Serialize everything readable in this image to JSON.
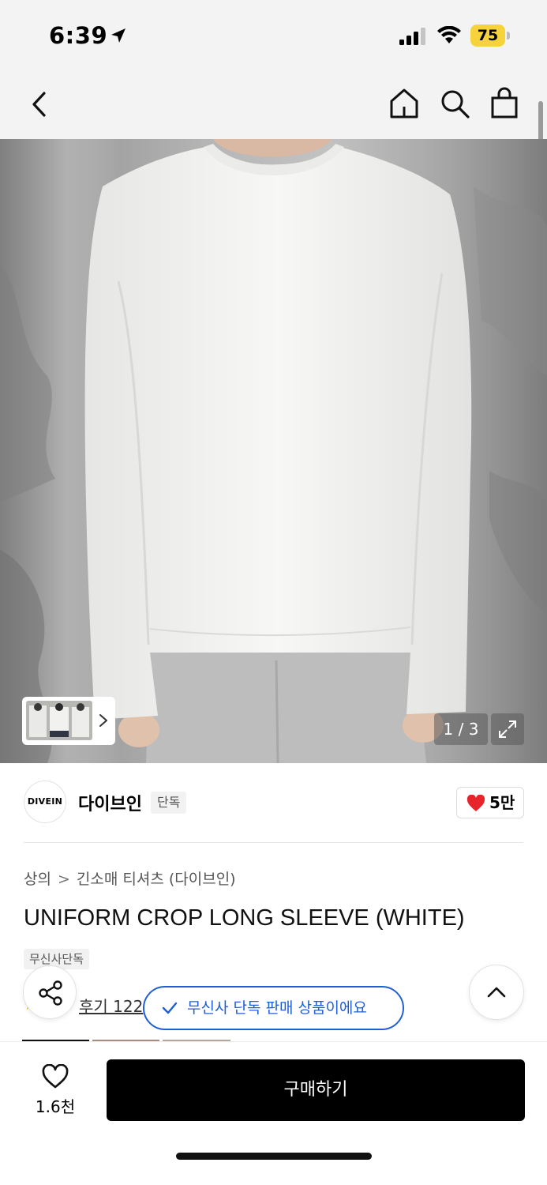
{
  "status_bar": {
    "time": "6:39",
    "battery": "75",
    "icons": [
      "location-arrow-icon",
      "cellular-signal-icon",
      "wifi-icon",
      "battery-icon"
    ]
  },
  "nav": {
    "icons": [
      "back-chevron-icon",
      "home-icon",
      "search-icon",
      "shopping-bag-icon"
    ]
  },
  "gallery": {
    "counter": "1 / 3",
    "icons": [
      "chevron-right-icon",
      "expand-icon"
    ]
  },
  "brand": {
    "logo_text": "DIVEIN",
    "name": "다이브인",
    "badge": "단독",
    "likes": "5만",
    "like_color": "#e8232b"
  },
  "product": {
    "breadcrumb": [
      "상의",
      "긴소매 티셔츠 (다이브인)"
    ],
    "breadcrumb_separator": ">",
    "title": "UNIFORM CROP LONG SLEEVE (WHITE)",
    "tag": "무신사단독",
    "review": "후기 122"
  },
  "toast": {
    "text": "무신사 단독 판매 상품이에요",
    "color": "#1f5fd6"
  },
  "bottom": {
    "wish_count": "1.6천",
    "buy_label": "구매하기"
  }
}
